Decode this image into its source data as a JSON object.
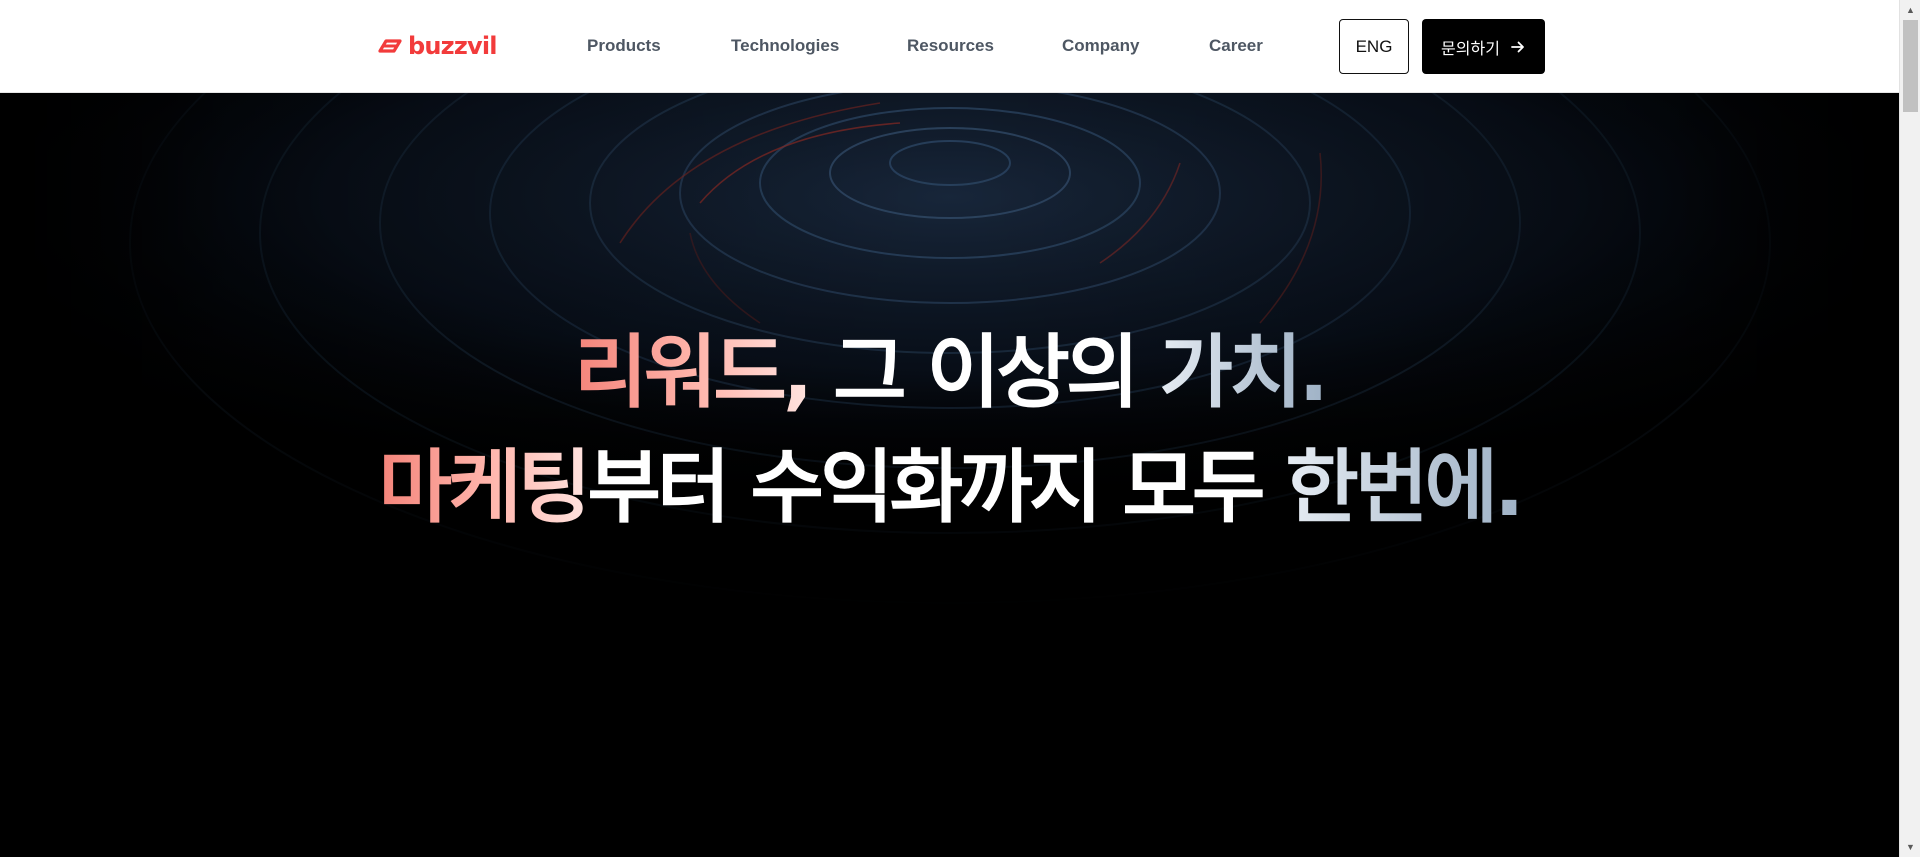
{
  "header": {
    "logo_text": "buzzvil",
    "brand_color": "#f23b3b",
    "nav": [
      {
        "label": "Products"
      },
      {
        "label": "Technologies"
      },
      {
        "label": "Resources"
      },
      {
        "label": "Company"
      },
      {
        "label": "Career"
      }
    ],
    "lang_button": "ENG",
    "contact_button": "문의하기",
    "contact_icon": "arrow-right-icon"
  },
  "hero": {
    "line1": {
      "part_red": "리워드,",
      "part_white": " 그 이상의 ",
      "part_blue": "가치."
    },
    "line2": {
      "part_red": "마케팅",
      "part_white": "부터 수익화까지 모두 ",
      "part_blue": "한번에."
    }
  }
}
